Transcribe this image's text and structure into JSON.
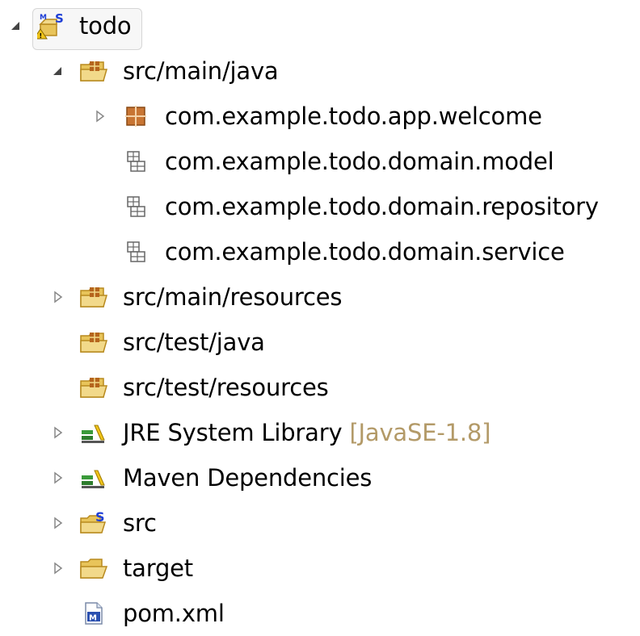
{
  "project": {
    "label": "todo",
    "icon": "maven-project-icon"
  },
  "tree": [
    {
      "label": "src/main/java",
      "icon": "source-folder-icon",
      "expanded": true
    },
    {
      "label": "com.example.todo.app.welcome",
      "icon": "package-icon"
    },
    {
      "label": "com.example.todo.domain.model",
      "icon": "empty-package-icon"
    },
    {
      "label": "com.example.todo.domain.repository",
      "icon": "empty-package-icon"
    },
    {
      "label": "com.example.todo.domain.service",
      "icon": "empty-package-icon"
    },
    {
      "label": "src/main/resources",
      "icon": "source-folder-icon"
    },
    {
      "label": "src/test/java",
      "icon": "source-folder-icon"
    },
    {
      "label": "src/test/resources",
      "icon": "source-folder-icon"
    },
    {
      "label": "JRE System Library",
      "decoration": "[JavaSE-1.8]",
      "icon": "library-icon"
    },
    {
      "label": "Maven Dependencies",
      "icon": "library-icon"
    },
    {
      "label": "src",
      "icon": "spring-folder-icon"
    },
    {
      "label": "target",
      "icon": "folder-icon"
    },
    {
      "label": "pom.xml",
      "icon": "maven-pom-icon"
    }
  ],
  "colors": {
    "folder": "#e8c45a",
    "folder_dark": "#b88a1e",
    "package": "#b5651d",
    "library_green": "#3a9a3a",
    "library_yellow": "#f0c419",
    "decoration": "#b39a68",
    "spring_blue": "#1f3fd6"
  }
}
